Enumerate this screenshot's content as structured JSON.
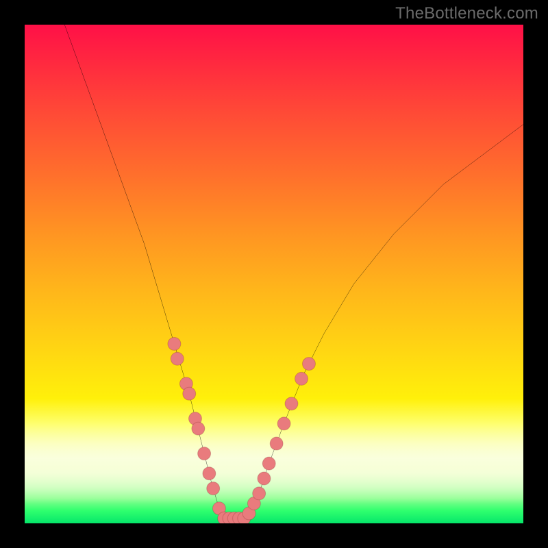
{
  "watermark": "TheBottleneck.com",
  "chart_data": {
    "type": "line",
    "title": "",
    "xlabel": "",
    "ylabel": "",
    "xlim": [
      0,
      100
    ],
    "ylim": [
      0,
      100
    ],
    "series": [
      {
        "name": "bottleneck-curve",
        "x": [
          8,
          12,
          16,
          20,
          24,
          27,
          30,
          33,
          35,
          37.5,
          39,
          40,
          41,
          44,
          47,
          49,
          52,
          56,
          60,
          66,
          74,
          84,
          96,
          100
        ],
        "values": [
          100,
          89,
          78,
          67,
          56,
          46,
          36,
          26,
          18,
          8,
          3,
          1,
          1,
          1,
          6,
          12,
          20,
          30,
          38,
          48,
          58,
          68,
          77,
          80
        ]
      }
    ],
    "markers": {
      "name": "highlighted-points",
      "color": "#e97b7d",
      "points": [
        {
          "x": 30.0,
          "y": 36
        },
        {
          "x": 30.6,
          "y": 33
        },
        {
          "x": 32.4,
          "y": 28
        },
        {
          "x": 33.0,
          "y": 26
        },
        {
          "x": 34.2,
          "y": 21
        },
        {
          "x": 34.8,
          "y": 19
        },
        {
          "x": 36.0,
          "y": 14
        },
        {
          "x": 37.0,
          "y": 10
        },
        {
          "x": 37.8,
          "y": 7
        },
        {
          "x": 39.0,
          "y": 3
        },
        {
          "x": 40.0,
          "y": 1
        },
        {
          "x": 41.0,
          "y": 1
        },
        {
          "x": 42.0,
          "y": 1
        },
        {
          "x": 43.0,
          "y": 1
        },
        {
          "x": 44.0,
          "y": 1
        },
        {
          "x": 45.0,
          "y": 2
        },
        {
          "x": 46.0,
          "y": 4
        },
        {
          "x": 47.0,
          "y": 6
        },
        {
          "x": 48.0,
          "y": 9
        },
        {
          "x": 49.0,
          "y": 12
        },
        {
          "x": 50.5,
          "y": 16
        },
        {
          "x": 52.0,
          "y": 20
        },
        {
          "x": 53.5,
          "y": 24
        },
        {
          "x": 55.5,
          "y": 29
        },
        {
          "x": 57.0,
          "y": 32
        }
      ]
    },
    "colors": {
      "curve": "#000000",
      "gradient_top": "#ff1047",
      "gradient_mid": "#ffdd10",
      "gradient_bottom": "#06e66a",
      "marker": "#e97b7d"
    }
  }
}
